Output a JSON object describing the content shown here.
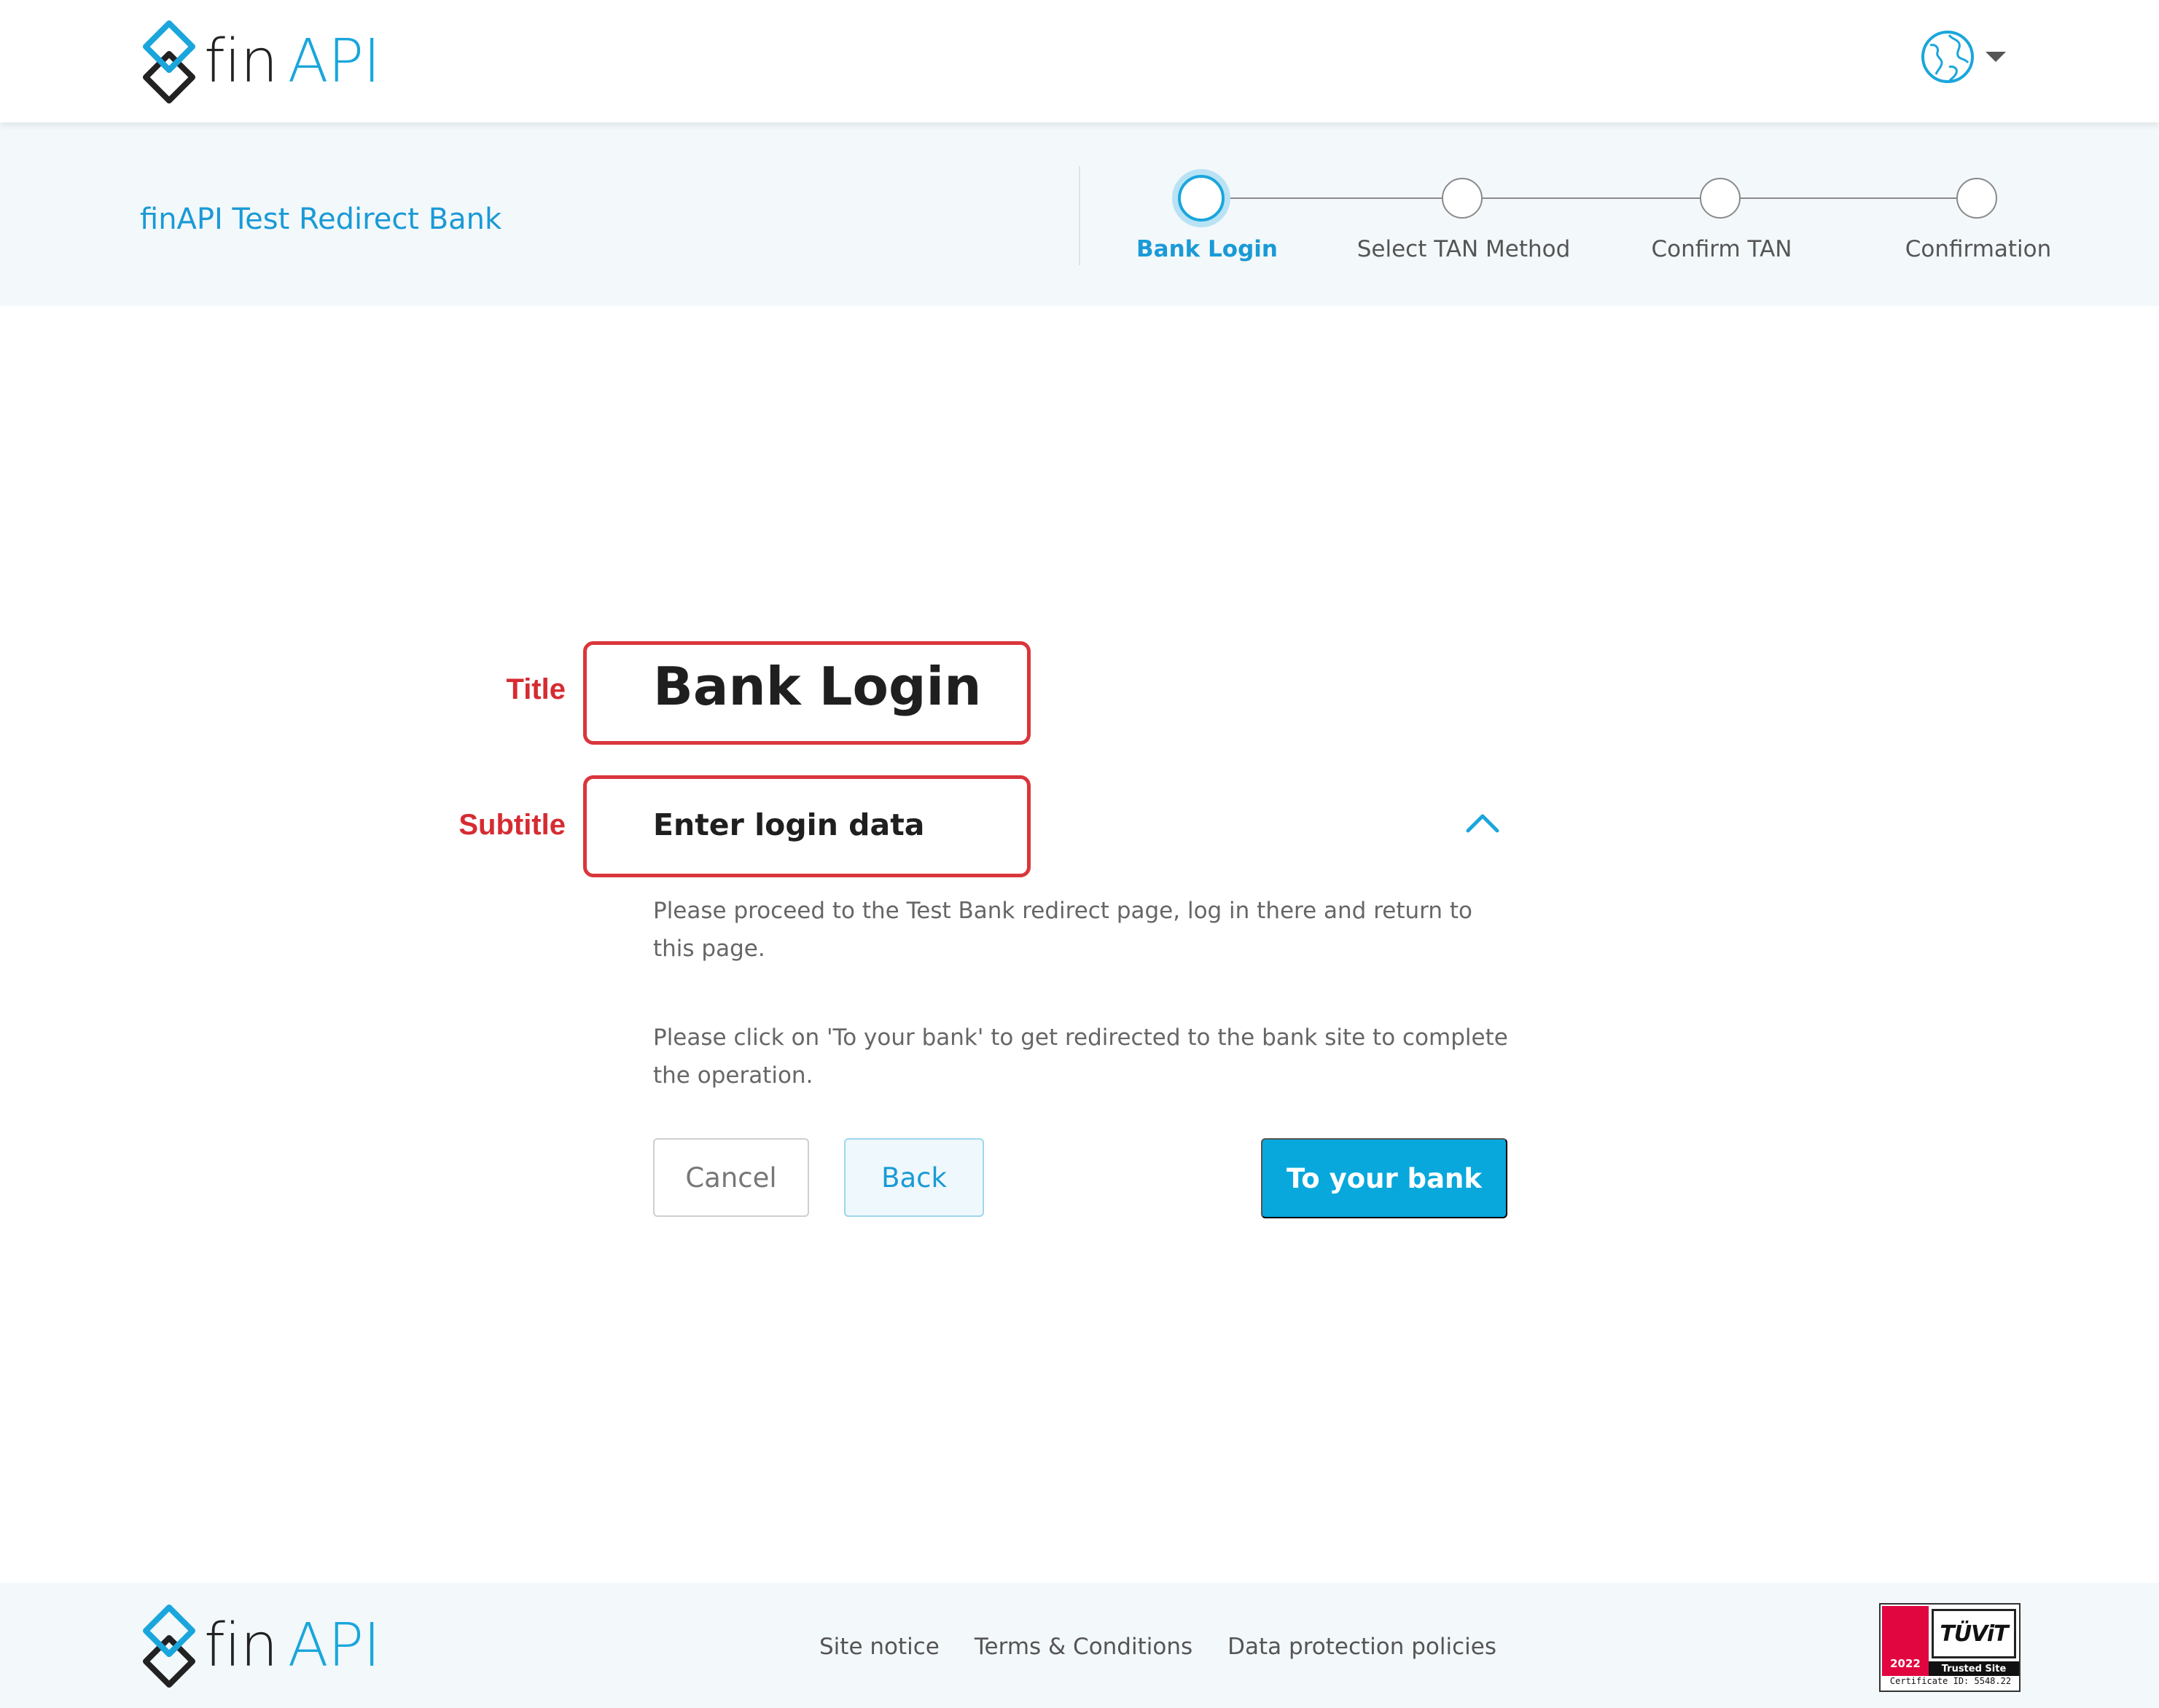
{
  "brand": {
    "fin": "fin",
    "api": "API"
  },
  "header": {
    "language_icon": "globe-icon",
    "language_caret_icon": "caret-down-icon"
  },
  "bank_bar": {
    "bank_name": "finAPI Test Redirect Bank"
  },
  "stepper": {
    "steps": [
      {
        "label": "Bank Login",
        "active": true
      },
      {
        "label": "Select TAN Method",
        "active": false
      },
      {
        "label": "Confirm TAN",
        "active": false
      },
      {
        "label": "Confirmation",
        "active": false
      }
    ]
  },
  "annotations": {
    "title_label": "Title",
    "subtitle_label": "Subtitle"
  },
  "main": {
    "title": "Bank Login",
    "subtitle": "Enter login data",
    "collapse_icon": "chevron-up-icon",
    "paragraph_1": "Please proceed to the Test Bank redirect page, log in there and return to this page.",
    "paragraph_2": "Please click on 'To your bank' to get redirected to the bank site to complete the operation.",
    "buttons": {
      "cancel": "Cancel",
      "back": "Back",
      "to_bank": "To your bank"
    }
  },
  "footer": {
    "links": [
      "Site notice",
      "Terms & Conditions",
      "Data protection policies"
    ],
    "seal": {
      "brand": "TÜViT",
      "year": "2022",
      "band": "Trusted Site",
      "certificate": "Certificate ID: 5548.22"
    }
  },
  "colors": {
    "accent": "#1aa6dc",
    "primary_button": "#08a8dc",
    "annotation": "#d9363b",
    "bar_bg": "#f3f8fb"
  }
}
